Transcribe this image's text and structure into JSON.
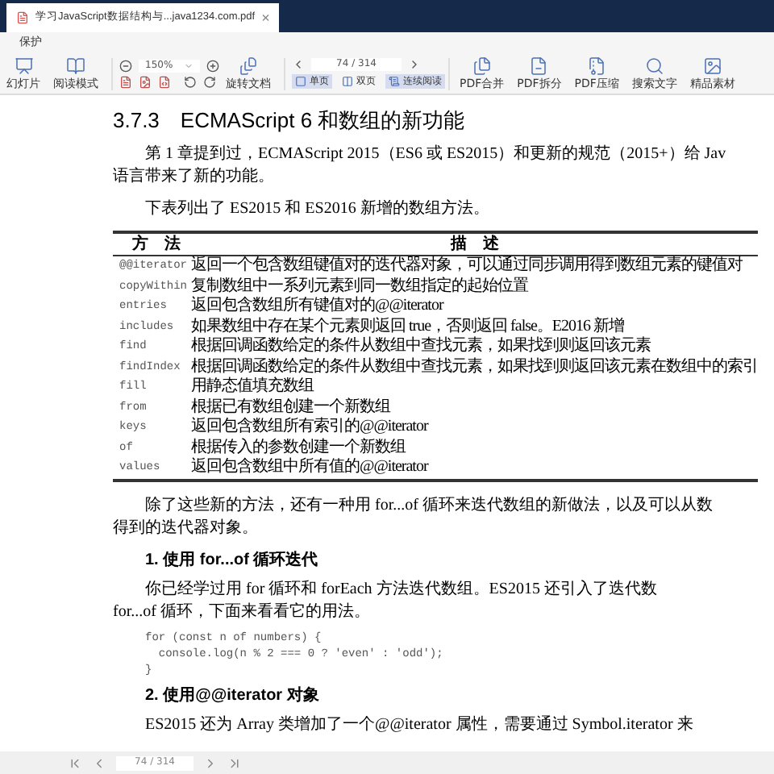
{
  "tab": {
    "title": "学习JavaScript数据结构与...java1234.com.pdf",
    "close": "×"
  },
  "menu": [
    "保护"
  ],
  "toolbar": {
    "left": [
      {
        "kind": "slides",
        "label": "幻灯片"
      },
      {
        "kind": "read",
        "label": "阅读模式"
      }
    ],
    "zoom": "150%",
    "rotate_label": "旋转文档",
    "page": "74 / 314",
    "views": [
      {
        "label": "单页",
        "selected": true
      },
      {
        "label": "双页",
        "selected": false
      },
      {
        "label": "连续阅读",
        "selected": true
      }
    ],
    "tools": [
      {
        "kind": "merge",
        "label": "PDF合并"
      },
      {
        "kind": "split",
        "label": "PDF拆分"
      },
      {
        "kind": "compress",
        "label": "PDF压缩"
      },
      {
        "kind": "search",
        "label": "搜索文字"
      },
      {
        "kind": "material",
        "label": "精品素材"
      }
    ]
  },
  "document": {
    "heading": "3.7.3　ECMAScript 6 和数组的新功能",
    "intro": [
      "第 1 章提到过，ECMAScript 2015（ES6 或 ES2015）和更新的规范（2015+）给 Jav",
      "语言带来了新的功能。"
    ],
    "table_intro": "下表列出了 ES2015 和 ES2016 新增的数组方法。",
    "table": {
      "columns": [
        "方　法",
        "描　述"
      ],
      "rows": [
        [
          "@@iterator",
          "返回一个包含数组键值对的迭代器对象，可以通过同步调用得到数组元素的键值对"
        ],
        [
          "copyWithin",
          "复制数组中一系列元素到同一数组指定的起始位置"
        ],
        [
          "entries",
          "返回包含数组所有键值对的@@iterator"
        ],
        [
          "includes",
          "如果数组中存在某个元素则返回 true，否则返回 false。E2016 新增"
        ],
        [
          "find",
          "根据回调函数给定的条件从数组中查找元素，如果找到则返回该元素"
        ],
        [
          "findIndex",
          "根据回调函数给定的条件从数组中查找元素，如果找到则返回该元素在数组中的索引"
        ],
        [
          "fill",
          "用静态值填充数组"
        ],
        [
          "from",
          "根据已有数组创建一个新数组"
        ],
        [
          "keys",
          "返回包含数组所有索引的@@iterator"
        ],
        [
          "of",
          "根据传入的参数创建一个新数组"
        ],
        [
          "values",
          "返回包含数组中所有值的@@iterator"
        ]
      ]
    },
    "after_table": [
      "除了这些新的方法，还有一种用 for...of 循环来迭代数组的新做法，以及可以从数",
      "得到的迭代器对象。"
    ],
    "section1": "1. 使用 for...of 循环迭代",
    "section1_text": [
      "你已经学过用 for 循环和 forEach 方法迭代数组。ES2015 还引入了迭代数",
      "for...of 循环，下面来看看它的用法。"
    ],
    "code": [
      "for (const n of numbers) {",
      "  console.log(n % 2 === 0 ? 'even' : 'odd');",
      "}"
    ],
    "section2": "2. 使用@@iterator 对象",
    "section2_text": "ES2015 还为 Array 类增加了一个@@iterator 属性，需要通过 Symbol.iterator 来"
  },
  "bottom_bar": {
    "page": "74 / 314"
  }
}
